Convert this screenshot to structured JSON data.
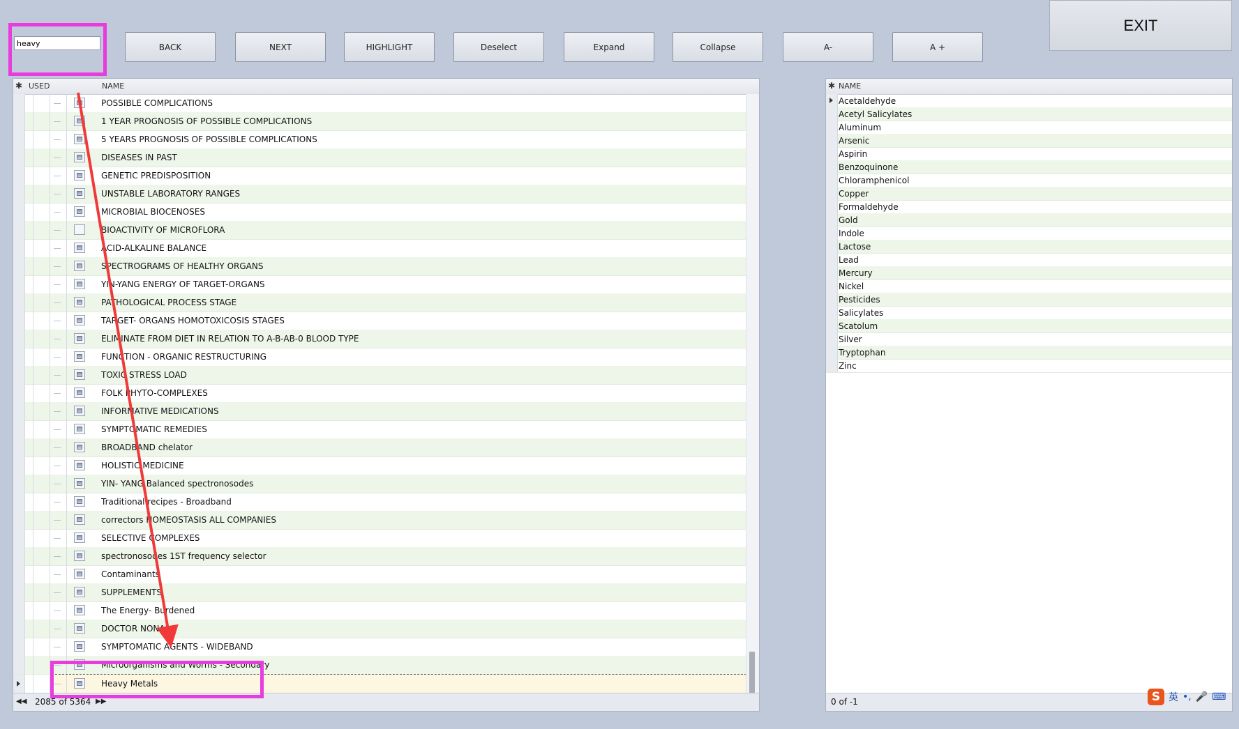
{
  "search": {
    "value": "heavy"
  },
  "toolbar": {
    "buttons": [
      "BACK",
      "NEXT",
      "HIGHLIGHT",
      "Deselect",
      "Expand",
      "Collapse",
      "A-",
      "A +"
    ],
    "exit_label": "EXIT"
  },
  "left_table": {
    "columns": {
      "used": "USED",
      "name": "NAME"
    },
    "rows": [
      "POSSIBLE COMPLICATIONS",
      "1 YEAR PROGNOSIS OF POSSIBLE COMPLICATIONS",
      "5 YEARS PROGNOSIS OF POSSIBLE COMPLICATIONS",
      "DISEASES IN PAST",
      "GENETIC PREDISPOSITION",
      "UNSTABLE LABORATORY RANGES",
      "MICROBIAL BIOCENOSES",
      "BIOACTIVITY OF MICROFLORA",
      "ACID-ALKALINE BALANCE",
      "SPECTROGRAMS OF HEALTHY ORGANS",
      "YIN-YANG ENERGY OF TARGET-ORGANS",
      "PATHOLOGICAL PROCESS STAGE",
      "TARGET- ORGANS HOMOTOXICOSIS STAGES",
      "ELIMINATE FROM DIET IN RELATION TO A-B-AB-0 BLOOD TYPE",
      "FUNCTION - ORGANIC RESTRUCTURING",
      "TOXIC STRESS LOAD",
      "FOLK PHYTO-COMPLEXES",
      "INFORMATIVE MEDICATIONS",
      "SYMPTOMATIC REMEDIES",
      "BROADBAND chelator",
      "HOLISTIC MEDICINE",
      "YIN- YANG Balanced spectronosodes",
      "Traditional recipes - Broadband",
      "correctors HOMEOSTASIS ALL COMPANIES",
      "SELECTIVE COMPLEXES",
      "spectronosodes 1ST frequency selector",
      "Contaminants",
      "SUPPLEMENTS",
      "The Energy- Burdened",
      "DOCTOR NONA",
      "SYMPTOMATIC AGENTS - WIDEBAND",
      "Microorganisms and Worms - Secondary",
      "Heavy Metals"
    ],
    "footer_count": "2085 of 5364"
  },
  "right_table": {
    "columns": {
      "name": "NAME"
    },
    "rows": [
      "Acetaldehyde",
      "Acetyl Salicylates",
      "Aluminum",
      "Arsenic",
      "Aspirin",
      "Benzoquinone",
      "Chloramphenicol",
      "Copper",
      "Formaldehyde",
      "Gold",
      "Indole",
      "Lactose",
      "Lead",
      "Mercury",
      "Nickel",
      "Pesticides",
      "Salicylates",
      "Scatolum",
      "Silver",
      "Tryptophan",
      "Zinc"
    ],
    "footer_count": "0 of -1"
  },
  "ime": {
    "logo": "S",
    "lang": "英",
    "punct": "•,",
    "mic": "🎤",
    "keyboard": "⌨"
  },
  "colors": {
    "highlight": "#e83cdc",
    "arrow": "#f03a3a"
  }
}
